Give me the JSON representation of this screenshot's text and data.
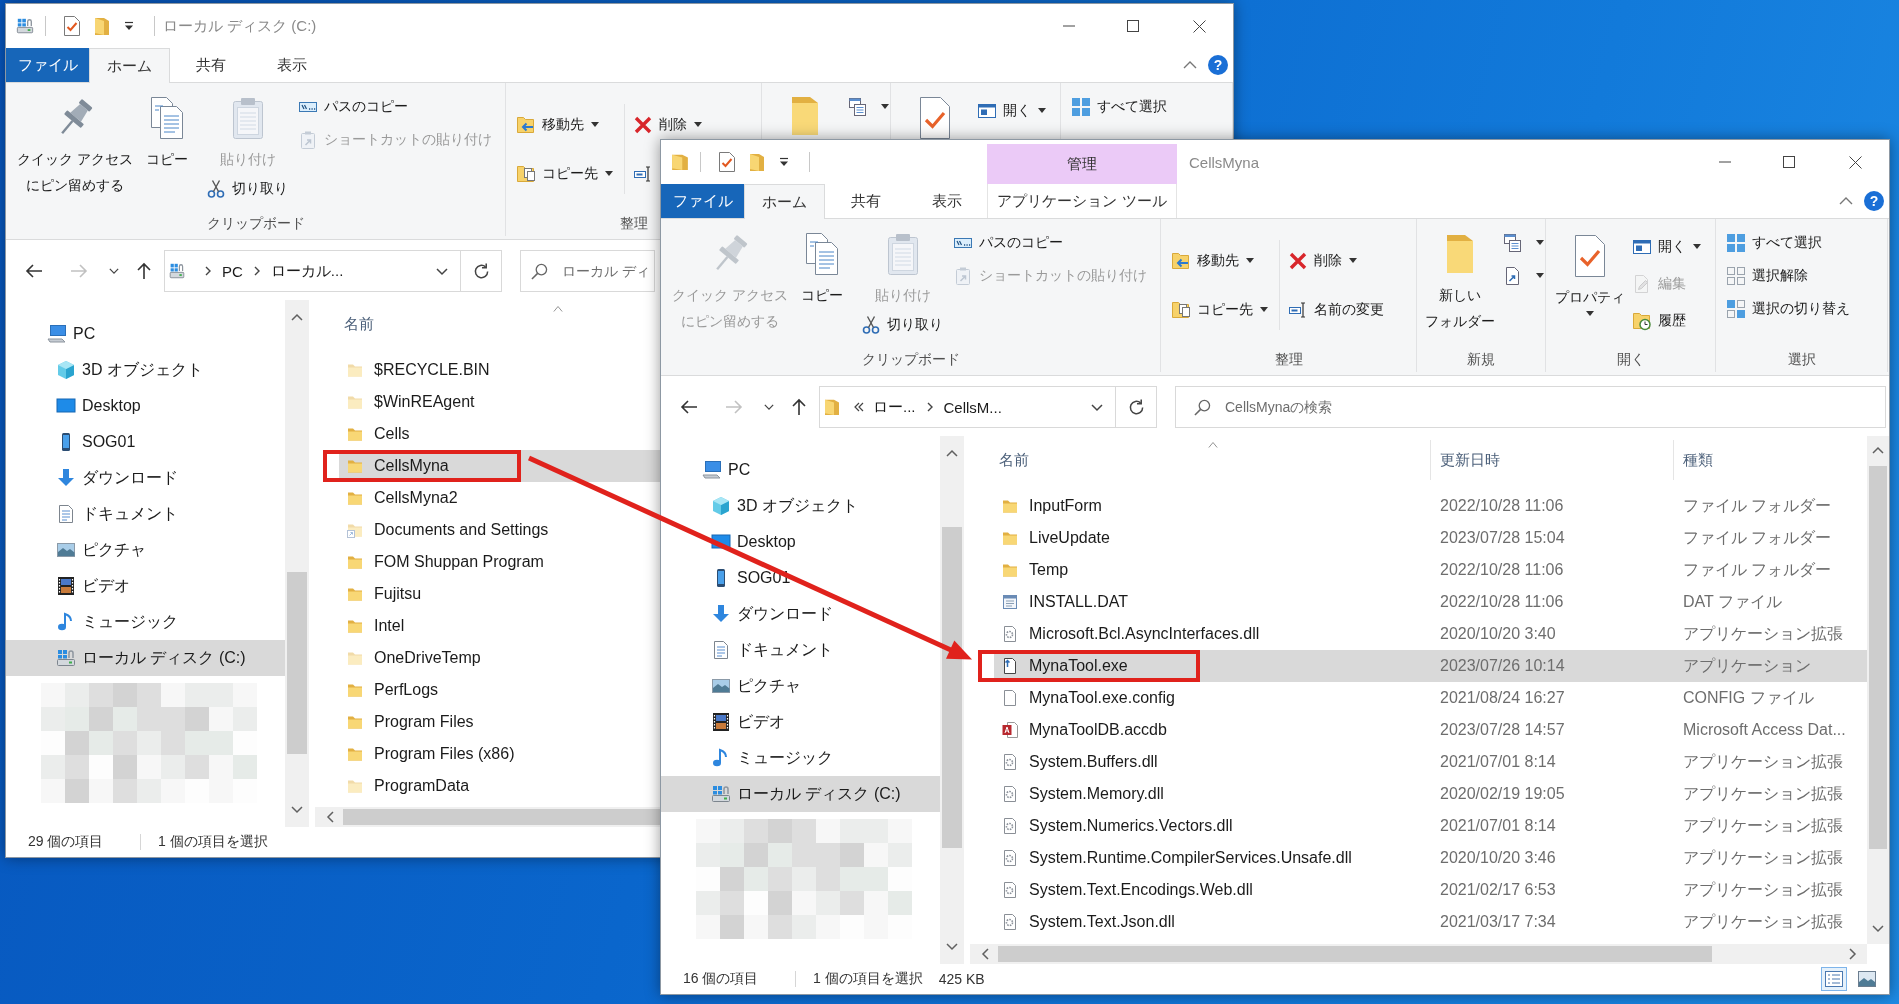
{
  "windows": [
    {
      "title": "ローカル ディスク (C:)",
      "tabs": [
        {
          "label": "ファイル",
          "kind": "file",
          "selected": false
        },
        {
          "label": "ホーム",
          "kind": "tab",
          "selected": true
        },
        {
          "label": "共有",
          "kind": "tab",
          "selected": false
        },
        {
          "label": "表示",
          "kind": "tab",
          "selected": false
        }
      ],
      "help": "?",
      "ribbon": [
        {
          "label": "クリップボード",
          "items": [
            {
              "kind": "large",
              "label": "クイック アクセスにピン留めする",
              "disabled": false,
              "dropdown": false
            },
            {
              "kind": "large",
              "label": "コピー",
              "disabled": false,
              "dropdown": false
            },
            {
              "kind": "large",
              "label": "貼り付け",
              "disabled": true,
              "dropdown": false
            },
            {
              "kind": "small",
              "label": "パスのコピー",
              "disabled": false,
              "dropdown": false
            },
            {
              "kind": "small",
              "label": "ショートカットの貼り付け",
              "disabled": true,
              "dropdown": false
            },
            {
              "kind": "small",
              "label": "切り取り",
              "disabled": false,
              "dropdown": false
            }
          ]
        },
        {
          "label": "整理",
          "items": [
            {
              "kind": "small",
              "label": "移動先",
              "disabled": false,
              "dropdown": true
            },
            {
              "kind": "small",
              "label": "コピー先",
              "disabled": false,
              "dropdown": true
            },
            {
              "kind": "small",
              "label": "削除",
              "disabled": false,
              "dropdown": true
            },
            {
              "kind": "small",
              "disabled": false,
              "dropdown": false
            }
          ]
        },
        {
          "items": [
            {
              "kind": "large",
              "disabled": false,
              "dropdown": false
            },
            {
              "kind": "small",
              "disabled": false,
              "dropdown": true
            }
          ]
        },
        {
          "items": [
            {
              "kind": "large",
              "disabled": false,
              "dropdown": false
            },
            {
              "kind": "small",
              "label": "開く",
              "disabled": false,
              "dropdown": true
            }
          ]
        },
        {
          "items": [
            {
              "kind": "small",
              "label": "すべて選択",
              "disabled": false,
              "dropdown": false
            }
          ]
        }
      ],
      "navigation_buttons": [
        {
          "disabled": false
        },
        {
          "disabled": true
        },
        {
          "disabled": false
        },
        {
          "disabled": false
        }
      ],
      "address": {
        "overflow": false,
        "segments": [
          "PC",
          "ローカル..."
        ]
      },
      "search": {
        "placeholder": "ローカル ディ"
      },
      "navigation": [
        {
          "label": "PC",
          "selected": false,
          "children": [
            {
              "label": "3D オブジェクト",
              "selected": false
            },
            {
              "label": "Desktop",
              "selected": false
            },
            {
              "label": "SOG01",
              "selected": false
            },
            {
              "label": "ダウンロード",
              "selected": false
            },
            {
              "label": "ドキュメント",
              "selected": false
            },
            {
              "label": "ピクチャ",
              "selected": false
            },
            {
              "label": "ビデオ",
              "selected": false
            },
            {
              "label": "ミュージック",
              "selected": false
            },
            {
              "label": "ローカル ディスク (C:)",
              "selected": true
            }
          ]
        }
      ],
      "files": {
        "columns": [
          "名前"
        ],
        "rows": [
          {
            "name": "$RECYCLE.BIN",
            "kind": "folder",
            "hidden": true,
            "selected": false,
            "marked": false
          },
          {
            "name": "$WinREAgent",
            "kind": "folder",
            "hidden": true,
            "selected": false,
            "marked": false
          },
          {
            "name": "Cells",
            "kind": "folder",
            "hidden": false,
            "selected": false,
            "marked": false
          },
          {
            "name": "CellsMyna",
            "kind": "folder",
            "hidden": false,
            "selected": true,
            "marked": true
          },
          {
            "name": "CellsMyna2",
            "kind": "folder",
            "hidden": false,
            "selected": false,
            "marked": false
          },
          {
            "name": "Documents and Settings",
            "kind": "junction",
            "hidden": true,
            "selected": false,
            "marked": false
          },
          {
            "name": "FOM Shuppan Program",
            "kind": "folder",
            "hidden": false,
            "selected": false,
            "marked": false
          },
          {
            "name": "Fujitsu",
            "kind": "folder",
            "hidden": false,
            "selected": false,
            "marked": false
          },
          {
            "name": "Intel",
            "kind": "folder",
            "hidden": false,
            "selected": false,
            "marked": false
          },
          {
            "name": "OneDriveTemp",
            "kind": "folder",
            "hidden": true,
            "selected": false,
            "marked": false
          },
          {
            "name": "PerfLogs",
            "kind": "folder",
            "hidden": false,
            "selected": false,
            "marked": false
          },
          {
            "name": "Program Files",
            "kind": "folder",
            "hidden": false,
            "selected": false,
            "marked": false
          },
          {
            "name": "Program Files (x86)",
            "kind": "folder",
            "hidden": false,
            "selected": false,
            "marked": false
          },
          {
            "name": "ProgramData",
            "kind": "folder",
            "hidden": true,
            "selected": false,
            "marked": false
          }
        ]
      },
      "status": {
        "item_count": "29 個の項目",
        "selection": "1 個の項目を選択"
      }
    },
    {
      "title": "CellsMyna",
      "contextual": "管理",
      "tabs": [
        {
          "label": "ファイル",
          "kind": "file",
          "selected": false
        },
        {
          "label": "ホーム",
          "kind": "tab",
          "selected": true
        },
        {
          "label": "共有",
          "kind": "tab",
          "selected": false
        },
        {
          "label": "表示",
          "kind": "tab",
          "selected": false
        },
        {
          "label": "アプリケーション ツール",
          "kind": "contextual",
          "selected": false
        }
      ],
      "help": "?",
      "ribbon": [
        {
          "label": "クリップボード",
          "items": [
            {
              "kind": "large",
              "label": "クイック アクセスにピン留めする",
              "disabled": true,
              "dropdown": false
            },
            {
              "kind": "large",
              "label": "コピー",
              "disabled": false,
              "dropdown": false
            },
            {
              "kind": "large",
              "label": "貼り付け",
              "disabled": true,
              "dropdown": false
            },
            {
              "kind": "small",
              "label": "パスのコピー",
              "disabled": false,
              "dropdown": false
            },
            {
              "kind": "small",
              "label": "ショートカットの貼り付け",
              "disabled": true,
              "dropdown": false
            },
            {
              "kind": "small",
              "label": "切り取り",
              "disabled": false,
              "dropdown": false
            }
          ]
        },
        {
          "label": "整理",
          "items": [
            {
              "kind": "small",
              "label": "移動先",
              "disabled": false,
              "dropdown": true
            },
            {
              "kind": "small",
              "label": "コピー先",
              "disabled": false,
              "dropdown": true
            },
            {
              "kind": "small",
              "label": "削除",
              "disabled": false,
              "dropdown": true
            },
            {
              "kind": "small",
              "label": "名前の変更",
              "disabled": false,
              "dropdown": false
            }
          ]
        },
        {
          "label": "新規",
          "items": [
            {
              "kind": "large",
              "label": "新しいフォルダー",
              "disabled": false,
              "dropdown": false
            },
            {
              "kind": "small",
              "disabled": false,
              "dropdown": true
            },
            {
              "kind": "small",
              "disabled": false,
              "dropdown": true
            }
          ]
        },
        {
          "label": "開く",
          "items": [
            {
              "kind": "large",
              "label": "プロパティ",
              "disabled": false,
              "dropdown": true
            },
            {
              "kind": "small",
              "label": "開く",
              "disabled": false,
              "dropdown": true
            },
            {
              "kind": "small",
              "label": "編集",
              "disabled": true,
              "dropdown": false
            },
            {
              "kind": "small",
              "label": "履歴",
              "disabled": false,
              "dropdown": false
            }
          ]
        },
        {
          "label": "選択",
          "items": [
            {
              "kind": "small",
              "label": "すべて選択",
              "disabled": false,
              "dropdown": false
            },
            {
              "kind": "small",
              "label": "選択解除",
              "disabled": false,
              "dropdown": false
            },
            {
              "kind": "small",
              "label": "選択の切り替え",
              "disabled": false,
              "dropdown": false
            }
          ]
        }
      ],
      "navigation_buttons": [
        {
          "disabled": false
        },
        {
          "disabled": true
        },
        {
          "disabled": false
        },
        {
          "disabled": false
        }
      ],
      "address": {
        "overflow": true,
        "segments": [
          "ロー...",
          "CellsM..."
        ]
      },
      "search": {
        "placeholder": "CellsMynaの検索"
      },
      "navigation": [
        {
          "label": "PC",
          "selected": false,
          "children": [
            {
              "label": "3D オブジェクト",
              "selected": false
            },
            {
              "label": "Desktop",
              "selected": false
            },
            {
              "label": "SOG01",
              "selected": false
            },
            {
              "label": "ダウンロード",
              "selected": false
            },
            {
              "label": "ドキュメント",
              "selected": false
            },
            {
              "label": "ピクチャ",
              "selected": false
            },
            {
              "label": "ビデオ",
              "selected": false
            },
            {
              "label": "ミュージック",
              "selected": false
            },
            {
              "label": "ローカル ディスク (C:)",
              "selected": true
            }
          ]
        }
      ],
      "files": {
        "columns": [
          "名前",
          "更新日時",
          "種類"
        ],
        "rows": [
          {
            "name": "InputForm",
            "modified": "2022/10/28 11:06",
            "type": "ファイル フォルダー",
            "kind": "folder",
            "hidden": false,
            "selected": false,
            "marked": false
          },
          {
            "name": "LiveUpdate",
            "modified": "2023/07/28 15:04",
            "type": "ファイル フォルダー",
            "kind": "folder",
            "hidden": false,
            "selected": false,
            "marked": false
          },
          {
            "name": "Temp",
            "modified": "2022/10/28 11:06",
            "type": "ファイル フォルダー",
            "kind": "folder",
            "hidden": false,
            "selected": false,
            "marked": false
          },
          {
            "name": "INSTALL.DAT",
            "modified": "2022/10/28 11:06",
            "type": "DAT ファイル",
            "kind": "data",
            "hidden": false,
            "selected": false,
            "marked": false
          },
          {
            "name": "Microsoft.Bcl.AsyncInterfaces.dll",
            "modified": "2020/10/20 3:40",
            "type": "アプリケーション拡張",
            "kind": "library",
            "hidden": false,
            "selected": false,
            "marked": false
          },
          {
            "name": "MynaTool.exe",
            "modified": "2023/07/26 10:14",
            "type": "アプリケーション",
            "kind": "program",
            "hidden": false,
            "selected": true,
            "marked": true
          },
          {
            "name": "MynaTool.exe.config",
            "modified": "2021/08/24 16:27",
            "type": "CONFIG ファイル",
            "kind": "config",
            "hidden": false,
            "selected": false,
            "marked": false
          },
          {
            "name": "MynaToolDB.accdb",
            "modified": "2023/07/28 14:57",
            "type": "Microsoft Access Dat...",
            "kind": "database",
            "hidden": false,
            "selected": false,
            "marked": false
          },
          {
            "name": "System.Buffers.dll",
            "modified": "2021/07/01 8:14",
            "type": "アプリケーション拡張",
            "kind": "library",
            "hidden": false,
            "selected": false,
            "marked": false
          },
          {
            "name": "System.Memory.dll",
            "modified": "2020/02/19 19:05",
            "type": "アプリケーション拡張",
            "kind": "library",
            "hidden": false,
            "selected": false,
            "marked": false
          },
          {
            "name": "System.Numerics.Vectors.dll",
            "modified": "2021/07/01 8:14",
            "type": "アプリケーション拡張",
            "kind": "library",
            "hidden": false,
            "selected": false,
            "marked": false
          },
          {
            "name": "System.Runtime.CompilerServices.Unsafe.dll",
            "modified": "2020/10/20 3:46",
            "type": "アプリケーション拡張",
            "kind": "library",
            "hidden": false,
            "selected": false,
            "marked": false
          },
          {
            "name": "System.Text.Encodings.Web.dll",
            "modified": "2021/02/17 6:53",
            "type": "アプリケーション拡張",
            "kind": "library",
            "hidden": false,
            "selected": false,
            "marked": false
          },
          {
            "name": "System.Text.Json.dll",
            "modified": "2021/03/17 7:34",
            "type": "アプリケーション拡張",
            "kind": "library",
            "hidden": false,
            "selected": false,
            "marked": false
          }
        ]
      },
      "status": {
        "item_count": "16 個の項目",
        "selection": "1 個の項目を選択",
        "size": "425 KB"
      },
      "views": [
        {
          "selected": true
        },
        {
          "selected": false
        }
      ]
    }
  ],
  "annotation_arrow": true
}
